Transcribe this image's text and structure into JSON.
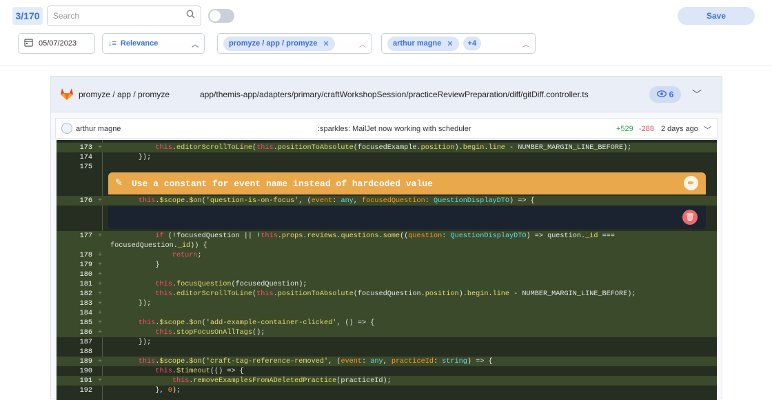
{
  "toolbar": {
    "counter": "3/170",
    "search_placeholder": "Search",
    "save_label": "Save"
  },
  "filters": {
    "date": "05/07/2023",
    "sort": "Relevance",
    "repo_chip": "promyze / app / promyze",
    "user_chip": "arthur magne",
    "user_more": "+4"
  },
  "file": {
    "repo": "promyze / app / promyze",
    "path": "app/themis-app/adapters/primary/craftWorkshopSession/practiceReviewPreparation/diff/gitDiff.controller.ts",
    "views": "6"
  },
  "commit": {
    "author": "arthur magne",
    "message": ":sparkles: MailJet now working with scheduler",
    "added": "+529",
    "removed": "-288",
    "time": "2 days ago"
  },
  "comment": {
    "title": "Use a constant for event name instead of hardcoded value"
  },
  "code": {
    "ln173": "173",
    "ln174": "174",
    "ln175": "175",
    "ln176": "176",
    "ln177": "177",
    "ln178": "178",
    "ln179": "179",
    "ln180": "180",
    "ln181": "181",
    "ln182": "182",
    "ln183": "183",
    "ln184": "184",
    "ln185": "185",
    "ln186": "186",
    "ln187": "187",
    "ln188": "188",
    "ln189": "189",
    "ln190": "190",
    "ln191": "191",
    "ln192": "192"
  }
}
